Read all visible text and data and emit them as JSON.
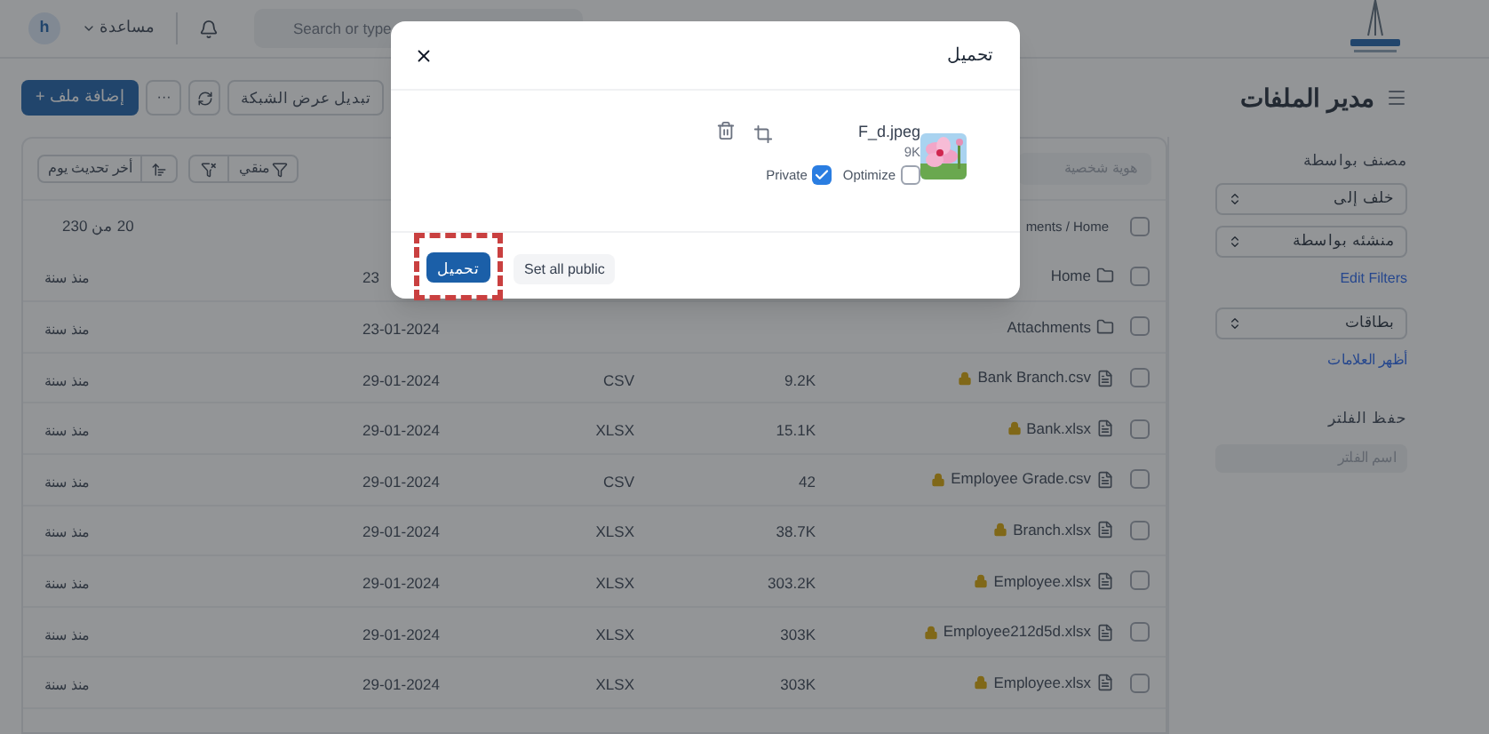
{
  "header": {
    "avatar": "h",
    "help": "مساعدة",
    "search": {
      "placeholder": "Search or type"
    }
  },
  "page": {
    "title": "مدير الملفات",
    "buttons": [
      {
        "kind": "plain",
        "label": "تبديل عرض الشبكة"
      },
      {
        "kind": "refresh"
      },
      {
        "kind": "more",
        "label": "···"
      },
      {
        "kind": "primary",
        "label": "+ إضافة ملف"
      }
    ]
  },
  "sidebar": {
    "sort_label": "مصنف بواسطة",
    "selects": [
      {
        "value": "خلف إلى"
      },
      {
        "value": "منشئه بواسطة"
      }
    ],
    "edit_filters": "Edit Filters",
    "tags_select": "بطاقات",
    "show_tags": "أظهر العلامات",
    "save_filter_label": "حفظ الفلتر",
    "filter_name": {
      "placeholder": "اسم الفلتر"
    }
  },
  "list": {
    "search": {
      "placeholder": "هوية شخصية"
    },
    "filter_button": "منقي",
    "sort_button": "أخر تحديث يوم",
    "breadcrumb": "ments / Home",
    "select_all": {
      "checked": false
    },
    "count": "20 من 230",
    "rows": [
      {
        "kind": "folder",
        "name": "Home",
        "checked": false,
        "locked": false,
        "date": "23",
        "modified": "منذ سنة"
      },
      {
        "kind": "folder",
        "name": "Attachments",
        "checked": false,
        "locked": false,
        "date": "23-01-2024",
        "modified": "منذ سنة"
      },
      {
        "kind": "file",
        "name": "Bank Branch.csv",
        "checked": false,
        "locked": true,
        "size": "9.2K",
        "type": "CSV",
        "date": "29-01-2024",
        "modified": "منذ سنة"
      },
      {
        "kind": "file",
        "name": "Bank.xlsx",
        "checked": false,
        "locked": true,
        "size": "15.1K",
        "type": "XLSX",
        "date": "29-01-2024",
        "modified": "منذ سنة"
      },
      {
        "kind": "file",
        "name": "Employee Grade.csv",
        "checked": false,
        "locked": true,
        "size": "42",
        "type": "CSV",
        "date": "29-01-2024",
        "modified": "منذ سنة"
      },
      {
        "kind": "file",
        "name": "Branch.xlsx",
        "checked": false,
        "locked": true,
        "size": "38.7K",
        "type": "XLSX",
        "date": "29-01-2024",
        "modified": "منذ سنة"
      },
      {
        "kind": "file",
        "name": "Employee.xlsx",
        "checked": false,
        "locked": true,
        "size": "303.2K",
        "type": "XLSX",
        "date": "29-01-2024",
        "modified": "منذ سنة"
      },
      {
        "kind": "file",
        "name": "Employee212d5d.xlsx",
        "checked": false,
        "locked": true,
        "size": "303K",
        "type": "XLSX",
        "date": "29-01-2024",
        "modified": "منذ سنة"
      },
      {
        "kind": "file",
        "name": "Employee.xlsx",
        "checked": false,
        "locked": true,
        "size": "303K",
        "type": "XLSX",
        "date": "29-01-2024",
        "modified": "منذ سنة"
      }
    ]
  },
  "modal": {
    "title": "تحميل",
    "file": {
      "name": "F_d.jpeg",
      "size": "9K",
      "optimize": {
        "label": "Optimize",
        "checked": false
      },
      "private": {
        "label": "Private",
        "checked": true
      }
    },
    "buttons": [
      {
        "kind": "secondary",
        "label": "Set all public",
        "highlighted": false
      },
      {
        "kind": "primary",
        "label": "تحميل",
        "highlighted": true
      }
    ]
  }
}
